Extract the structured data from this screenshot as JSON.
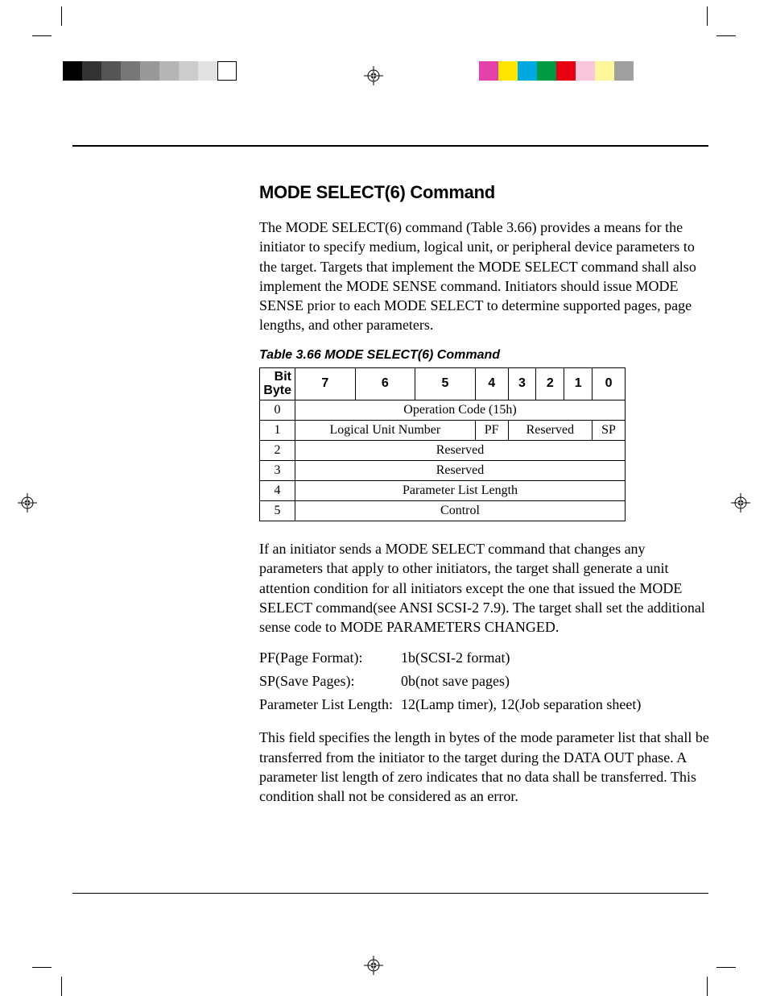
{
  "heading": "MODE SELECT(6) Command",
  "intro": "The MODE SELECT(6) command (Table 3.66) provides a means for the initiator to specify medium, logical unit, or peripheral device parameters to the target. Targets that implement the MODE SELECT command shall also implement the MODE SENSE command. Initiators should issue MODE SENSE prior to each MODE SELECT to determine supported pages, page lengths, and other parameters.",
  "table_caption": "Table 3.66  MODE SELECT(6) Command",
  "table": {
    "corner_top": "Bit",
    "corner_bottom": "Byte",
    "bits": [
      "7",
      "6",
      "5",
      "4",
      "3",
      "2",
      "1",
      "0"
    ],
    "rows": [
      {
        "byte": "0",
        "cells": [
          {
            "span": 8,
            "text": "Operation Code (15h)"
          }
        ]
      },
      {
        "byte": "1",
        "cells": [
          {
            "span": 3,
            "text": "Logical Unit Number"
          },
          {
            "span": 1,
            "text": "PF"
          },
          {
            "span": 3,
            "text": "Reserved"
          },
          {
            "span": 1,
            "text": "SP"
          }
        ]
      },
      {
        "byte": "2",
        "cells": [
          {
            "span": 8,
            "text": "Reserved"
          }
        ]
      },
      {
        "byte": "3",
        "cells": [
          {
            "span": 8,
            "text": "Reserved"
          }
        ]
      },
      {
        "byte": "4",
        "cells": [
          {
            "span": 8,
            "text": "Parameter List Length"
          }
        ]
      },
      {
        "byte": "5",
        "cells": [
          {
            "span": 8,
            "text": "Control"
          }
        ]
      }
    ]
  },
  "para2": "If an initiator sends a MODE SELECT command that changes any parameters that apply to other initiators, the target shall generate a unit attention condition for all initiators except the one that issued the MODE SELECT command(see ANSI SCSI-2 7.9). The target shall set the additional sense code to MODE PARAMETERS CHANGED.",
  "defs": [
    {
      "label": "PF(Page Format):",
      "value": "1b(SCSI-2 format)"
    },
    {
      "label": "SP(Save Pages):",
      "value": "0b(not save pages)"
    },
    {
      "label": "Parameter List Length:",
      "value": "12(Lamp timer), 12(Job separation sheet)"
    }
  ],
  "para3": "This field specifies the length in bytes of the mode parameter list that shall be transferred from the initiator to the target during the DATA OUT phase. A parameter list length of zero indicates that no data shall be transferred. This condition shall not be considered as an error.",
  "gray_shades": [
    "#000000",
    "#333333",
    "#555555",
    "#777777",
    "#999999",
    "#b5b5b5",
    "#cccccc",
    "#e2e2e2",
    "#ffffff"
  ],
  "color_swatches": [
    "#e542a9",
    "#ffe600",
    "#00a9e0",
    "#009944",
    "#e60012",
    "#f9c6dc",
    "#fff799",
    "#a0a0a0"
  ]
}
